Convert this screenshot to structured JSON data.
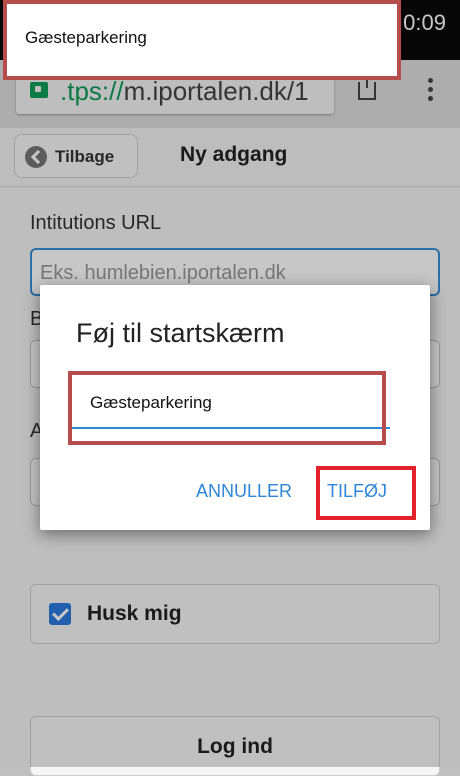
{
  "status_bar": {
    "time": "0:09"
  },
  "browser": {
    "url_scheme": ".tps://",
    "url_host": "m.iportalen.dk/1"
  },
  "page": {
    "back_label": "Tilbage",
    "title": "Ny adgang",
    "institution_label": "Intitutions URL",
    "institution_placeholder": "Eks. humlebien.iportalen.dk",
    "field2_label_partial": "B",
    "field3_label_partial": "A",
    "remember_label": "Husk mig",
    "login_label": "Log ind"
  },
  "dialog": {
    "title": "Føj til startskærm",
    "input_value": "Gæsteparkering",
    "cancel_label": "ANNULLER",
    "add_label": "TILFØJ"
  },
  "annotation": {
    "callout_text": "Gæsteparkering"
  }
}
